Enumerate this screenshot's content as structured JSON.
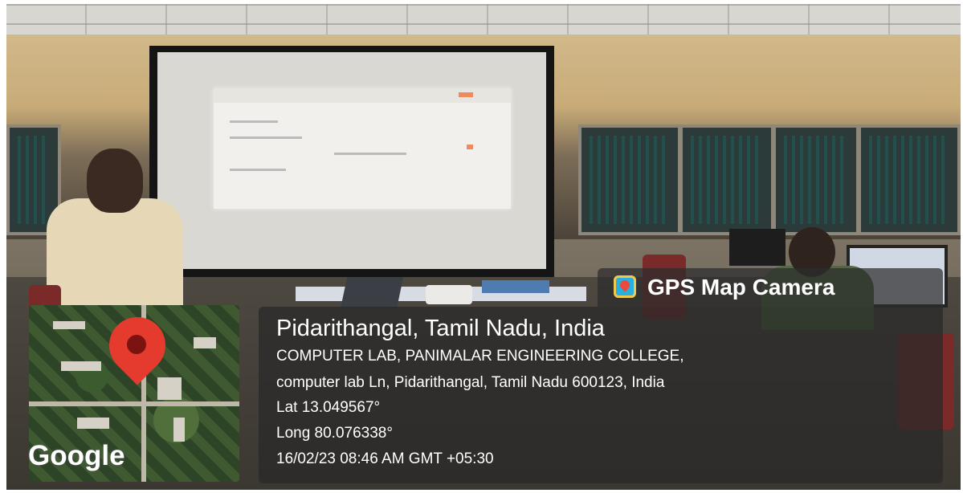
{
  "overlay": {
    "app_name": "GPS Map Camera",
    "place": "Pidarithangal, Tamil Nadu, India",
    "address_line1": "COMPUTER LAB, PANIMALAR ENGINEERING COLLEGE,",
    "address_line2": "computer lab Ln, Pidarithangal, Tamil Nadu 600123, India",
    "latitude": "Lat 13.049567°",
    "longitude": "Long 80.076338°",
    "datetime": "16/02/23 08:46 AM GMT +05:30",
    "map_brand": "Google"
  },
  "colors": {
    "overlay_bg": "#2d2d2d",
    "pin": "#e53b2e",
    "text": "#ffffff"
  }
}
